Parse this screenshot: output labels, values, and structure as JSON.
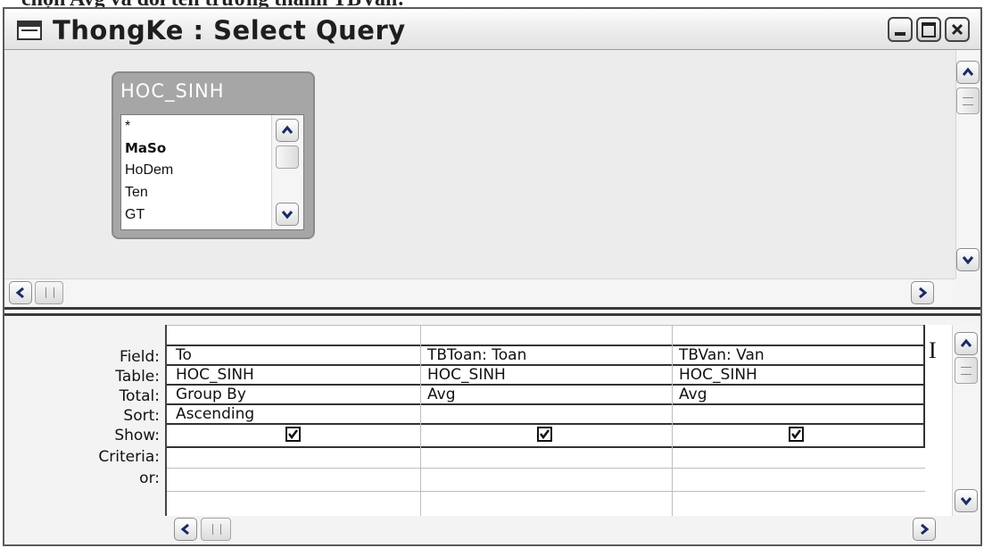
{
  "window": {
    "title": "ThongKe : Select Query",
    "caption_fragment": "chọn Avg và đổi tên trường thành TBVan:"
  },
  "table_pane": {
    "table": {
      "name": "HOC_SINH",
      "fields": [
        "*",
        "MaSo",
        "HoDem",
        "Ten",
        "GT"
      ],
      "primary_key": "MaSo"
    }
  },
  "design_grid": {
    "row_labels": [
      "Field:",
      "Table:",
      "Total:",
      "Sort:",
      "Show:",
      "Criteria:",
      "or:"
    ],
    "columns": [
      {
        "field": "To",
        "table": "HOC_SINH",
        "total": "Group By",
        "sort": "Ascending",
        "show": true,
        "criteria": "",
        "or": ""
      },
      {
        "field": "TBToan: Toan",
        "table": "HOC_SINH",
        "total": "Avg",
        "sort": "",
        "show": true,
        "criteria": "",
        "or": ""
      },
      {
        "field": "TBVan: Van",
        "table": "HOC_SINH",
        "total": "Avg",
        "sort": "",
        "show": true,
        "criteria": "",
        "or": ""
      }
    ]
  },
  "icons": {
    "window_icon": "query-design-icon",
    "minimize": "minimize-icon",
    "maximize": "maximize-icon",
    "close": "close-icon",
    "text_cursor": "text-cursor-icon"
  }
}
